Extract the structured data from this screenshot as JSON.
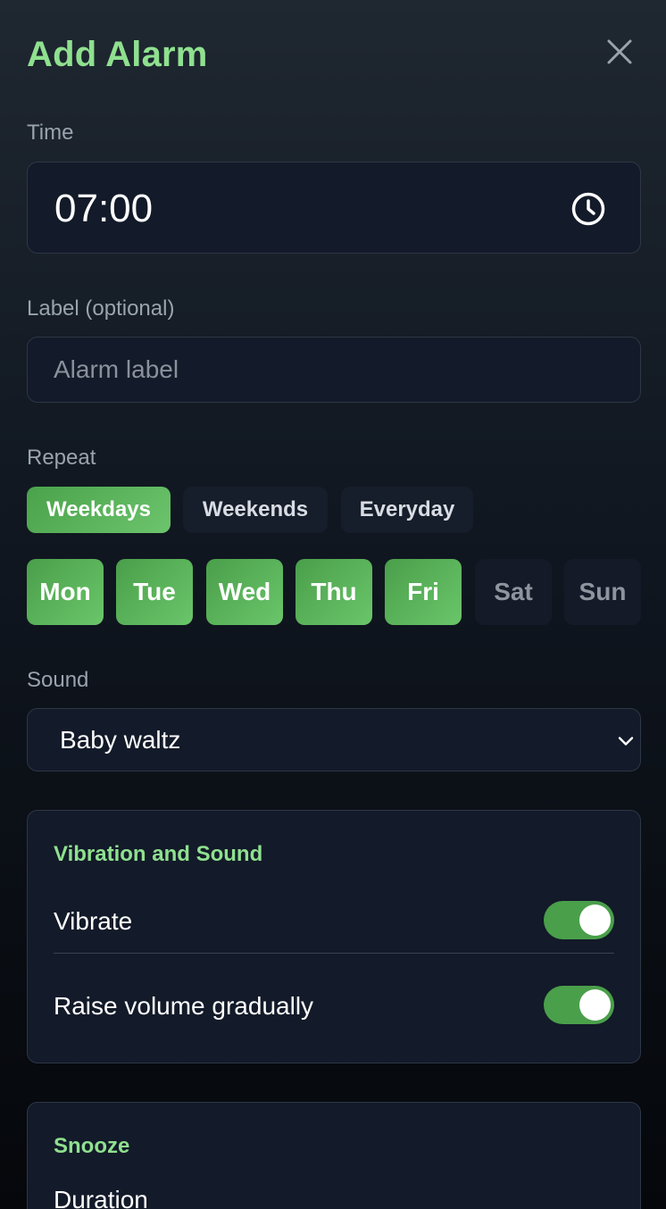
{
  "header": {
    "title": "Add Alarm"
  },
  "time": {
    "label": "Time",
    "value": "07:00"
  },
  "alarm_label": {
    "label": "Label (optional)",
    "placeholder": "Alarm label",
    "value": ""
  },
  "repeat": {
    "label": "Repeat",
    "presets": [
      {
        "label": "Weekdays",
        "selected": true
      },
      {
        "label": "Weekends",
        "selected": false
      },
      {
        "label": "Everyday",
        "selected": false
      }
    ],
    "days": [
      {
        "label": "Mon",
        "selected": true
      },
      {
        "label": "Tue",
        "selected": true
      },
      {
        "label": "Wed",
        "selected": true
      },
      {
        "label": "Thu",
        "selected": true
      },
      {
        "label": "Fri",
        "selected": true
      },
      {
        "label": "Sat",
        "selected": false
      },
      {
        "label": "Sun",
        "selected": false
      }
    ]
  },
  "sound": {
    "label": "Sound",
    "selected": "Baby waltz"
  },
  "vibration_card": {
    "title": "Vibration and Sound",
    "vibrate": {
      "label": "Vibrate",
      "enabled": true
    },
    "raise_volume": {
      "label": "Raise volume gradually",
      "enabled": true
    }
  },
  "snooze_card": {
    "title": "Snooze",
    "duration_label": "Duration"
  },
  "colors": {
    "accent": "#8fe08f",
    "active_green": "#4a9f4a",
    "field_bg": "#131a29",
    "muted_text": "#9aa3ae"
  },
  "icons": {
    "close": "close-icon",
    "clock": "clock-icon",
    "dropdown": "chevron-down-icon"
  }
}
